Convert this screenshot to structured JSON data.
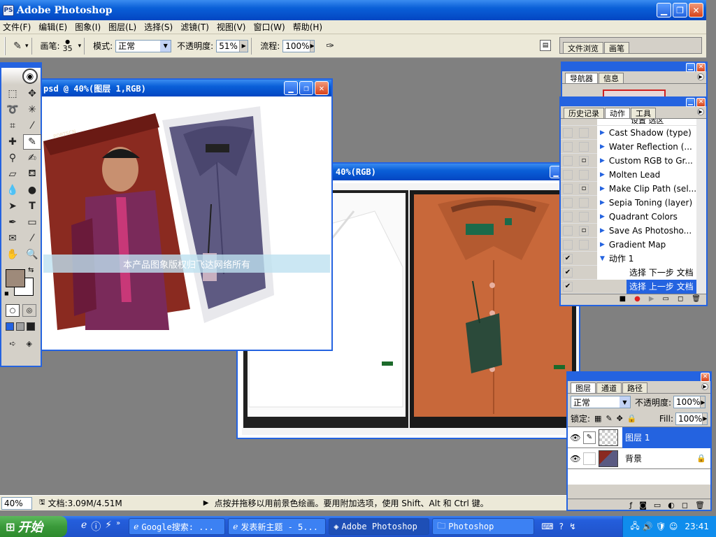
{
  "app": {
    "title": "Adobe Photoshop"
  },
  "menu": [
    "文件(F)",
    "编辑(E)",
    "图象(I)",
    "图层(L)",
    "选择(S)",
    "滤镜(T)",
    "视图(V)",
    "窗口(W)",
    "帮助(H)"
  ],
  "options": {
    "brush_label": "画笔:",
    "brush_size": "35",
    "mode_label": "模式:",
    "mode_value": "正常",
    "opacity_label": "不透明度:",
    "opacity_value": "51%",
    "flow_label": "流程:",
    "flow_value": "100%"
  },
  "palette_well": {
    "tabs": [
      "文件浏览",
      "画笔"
    ]
  },
  "doc1": {
    "title": "psd @ 40%(图层 1,RGB)",
    "watermark": "本产品图象版权归飞达网络所有",
    "box_brand": "PORTSCN"
  },
  "doc2": {
    "title": "40%(RGB)"
  },
  "navigator": {
    "tabs": [
      "导航器",
      "信息"
    ]
  },
  "actions_panel": {
    "tabs": [
      "历史记录",
      "动作",
      "工具"
    ],
    "partial_top": "设置 选区",
    "rows": [
      {
        "name": "Cast Shadow (type)",
        "c1": "",
        "c2": ""
      },
      {
        "name": "Water Reflection (...",
        "c1": "",
        "c2": ""
      },
      {
        "name": "Custom RGB to Gr...",
        "c1": "",
        "c2": "▫"
      },
      {
        "name": "Molten Lead",
        "c1": "",
        "c2": ""
      },
      {
        "name": "Make Clip Path (sel...",
        "c1": "",
        "c2": "▫"
      },
      {
        "name": "Sepia Toning (layer)",
        "c1": "",
        "c2": ""
      },
      {
        "name": "Quadrant Colors",
        "c1": "",
        "c2": ""
      },
      {
        "name": "Save As Photosho...",
        "c1": "",
        "c2": "▫"
      },
      {
        "name": "Gradient Map",
        "c1": "",
        "c2": ""
      }
    ],
    "set_name": "动作 1",
    "sub_rows": [
      "选择 下一步 文档",
      "选择 上一步 文档"
    ]
  },
  "layers_panel": {
    "tabs": [
      "图层",
      "通道",
      "路径"
    ],
    "blend": "正常",
    "opacity_label": "不透明度:",
    "opacity_value": "100%",
    "lock_label": "锁定:",
    "fill_label": "Fill:",
    "fill_value": "100%",
    "layers": [
      "图层 1",
      "背景"
    ]
  },
  "status": {
    "zoom": "40%",
    "doc_info": "文档:3.09M/4.51M",
    "hint": "点按并拖移以用前景色绘画。要用附加选项，使用 Shift、Alt 和 Ctrl 键。"
  },
  "taskbar": {
    "start": "开始",
    "items": [
      "Google搜索: ...",
      "发表新主题 - 5...",
      "Adobe Photoshop",
      "Photoshop"
    ],
    "clock": "23:41"
  },
  "colors": {
    "xp_blue": "#2463e0",
    "shirt_orange": "#c8683a",
    "shirt_purple": "#5a5a7a",
    "box_red": "#8a2a20",
    "fg_swatch": "#9e8a7a"
  }
}
